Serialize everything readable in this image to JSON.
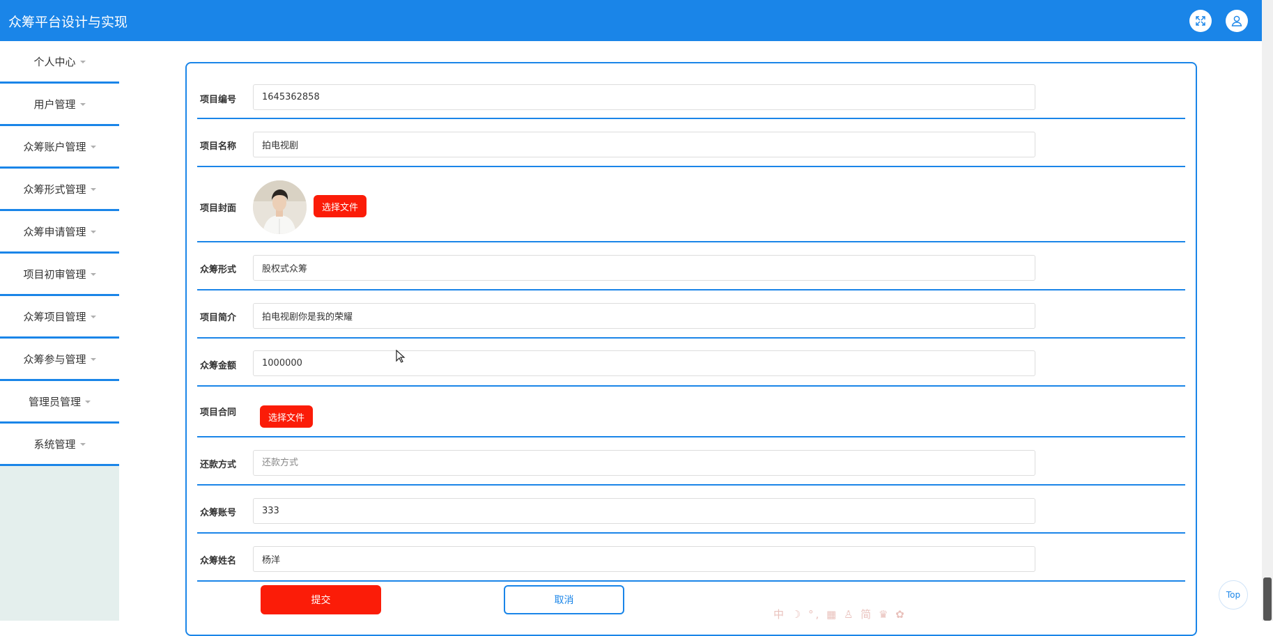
{
  "header": {
    "title": "众筹平台设计与实现",
    "fullscreen_icon": "expand-icon",
    "user_icon": "user-icon"
  },
  "sidebar": {
    "items": [
      {
        "label": "个人中心"
      },
      {
        "label": "用户管理"
      },
      {
        "label": "众筹账户管理"
      },
      {
        "label": "众筹形式管理"
      },
      {
        "label": "众筹申请管理"
      },
      {
        "label": "项目初审管理"
      },
      {
        "label": "众筹项目管理"
      },
      {
        "label": "众筹参与管理"
      },
      {
        "label": "管理员管理"
      },
      {
        "label": "系统管理"
      }
    ]
  },
  "form": {
    "project_no": {
      "label": "项目编号",
      "value": "1645362858"
    },
    "project_name": {
      "label": "项目名称",
      "value": "拍电视剧"
    },
    "cover": {
      "label": "项目封面",
      "button": "选择文件"
    },
    "crowd_form": {
      "label": "众筹形式",
      "value": "股权式众筹"
    },
    "intro": {
      "label": "项目简介",
      "value": "拍电视剧你是我的荣耀"
    },
    "amount": {
      "label": "众筹金额",
      "value": "1000000"
    },
    "contract": {
      "label": "项目合同",
      "button": "选择文件"
    },
    "repayment": {
      "label": "还款方式",
      "value": "",
      "placeholder": "还款方式"
    },
    "account": {
      "label": "众筹账号",
      "value": "333"
    },
    "name": {
      "label": "众筹姓名",
      "value": "杨洋"
    },
    "submit": "提交",
    "cancel": "取消"
  },
  "top_button": "Top",
  "ime_toolbar": "中 ☽ °, ▦ ♙ 简 ♛ ✿",
  "colors": {
    "primary": "#1a85e8",
    "danger": "#fb1c08",
    "sidebar_bg": "#e4efed"
  }
}
